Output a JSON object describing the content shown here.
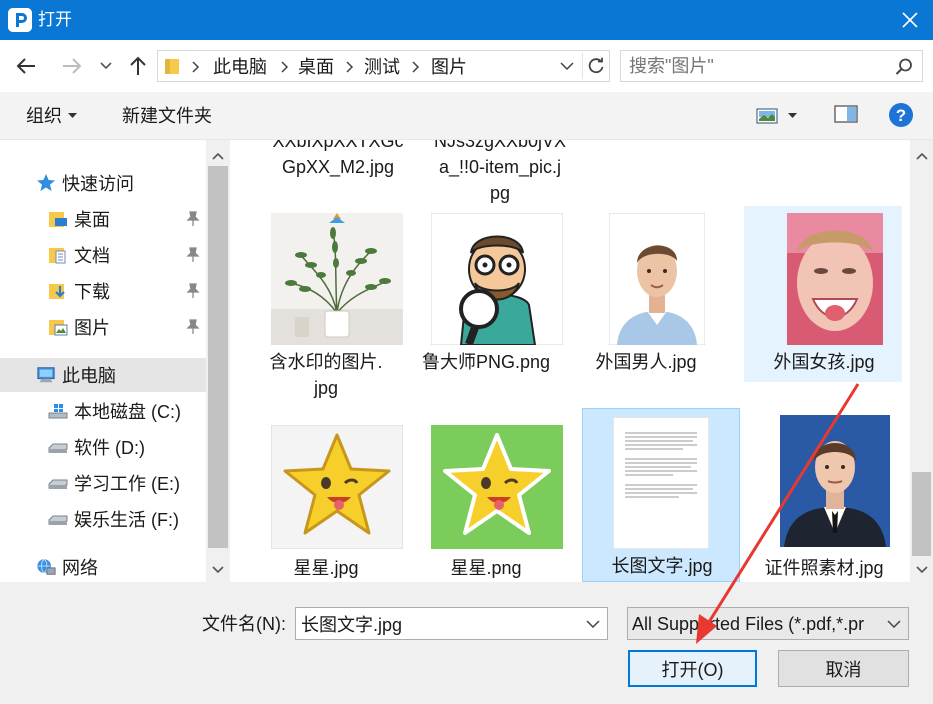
{
  "window": {
    "title": "打开",
    "close_glyph": "✕"
  },
  "nav": {
    "back_label": "back",
    "forward_label": "forward",
    "recent_label": "recent locations",
    "up_label": "up"
  },
  "address": {
    "breadcrumbs": [
      "此电脑",
      "桌面",
      "测试",
      "图片"
    ]
  },
  "search": {
    "placeholder": "搜索\"图片\""
  },
  "toolbar": {
    "organize_label": "组织",
    "new_folder_label": "新建文件夹",
    "help_label": "?"
  },
  "sidebar": {
    "items": [
      {
        "label": "快速访问",
        "icon": "star-icon",
        "level": 0
      },
      {
        "label": "桌面",
        "icon": "desktop-folder-icon",
        "level": 1,
        "pinned": true
      },
      {
        "label": "文档",
        "icon": "documents-folder-icon",
        "level": 1,
        "pinned": true
      },
      {
        "label": "下载",
        "icon": "downloads-folder-icon",
        "level": 1,
        "pinned": true
      },
      {
        "label": "图片",
        "icon": "pictures-folder-icon",
        "level": 1,
        "pinned": true
      },
      {
        "label": "此电脑",
        "icon": "computer-icon",
        "level": 0,
        "selected": true
      },
      {
        "label": "本地磁盘 (C:)",
        "icon": "windows-drive-icon",
        "level": 1
      },
      {
        "label": "软件 (D:)",
        "icon": "drive-icon",
        "level": 1
      },
      {
        "label": "学习工作 (E:)",
        "icon": "drive-icon",
        "level": 1
      },
      {
        "label": "娱乐生活 (F:)",
        "icon": "drive-icon",
        "level": 1
      },
      {
        "label": "网络",
        "icon": "network-icon",
        "level": 0
      }
    ]
  },
  "files": {
    "partial_top": [
      {
        "lines": [
          "XXbIXpXXTXGc",
          "GpXX_M2.jpg"
        ]
      },
      {
        "lines": [
          "NJs3zgXXb0jVX",
          "a_!!0-item_pic.j",
          "pg"
        ]
      }
    ],
    "items": [
      {
        "lines": [
          "含水印的图片.",
          "jpg"
        ],
        "thumb": "plant-photo"
      },
      {
        "lines": [
          "鲁大师PNG.png"
        ],
        "thumb": "ludashi-cartoon"
      },
      {
        "lines": [
          "外国男人.jpg"
        ],
        "thumb": "man-portrait"
      },
      {
        "lines": [
          "外国女孩.jpg"
        ],
        "thumb": "girl-portrait",
        "state": "hover"
      },
      {
        "lines": [
          "星星.jpg"
        ],
        "thumb": "star-cartoon-white"
      },
      {
        "lines": [
          "星星.png"
        ],
        "thumb": "star-cartoon-green"
      },
      {
        "lines": [
          "长图文字.jpg"
        ],
        "thumb": "text-document",
        "state": "selected"
      },
      {
        "lines": [
          "证件照素材.jpg"
        ],
        "thumb": "suit-portrait"
      }
    ]
  },
  "bottom": {
    "filename_label": "文件名(N):",
    "filename_value": "长图文字.jpg",
    "filetype_value": "All Supported Files (*.pdf,*.pr",
    "open_label": "打开(O)",
    "cancel_label": "取消"
  },
  "colors": {
    "titlebar": "#0b77d4",
    "selection": "#cce8ff",
    "annotation_arrow": "#e8382f"
  }
}
